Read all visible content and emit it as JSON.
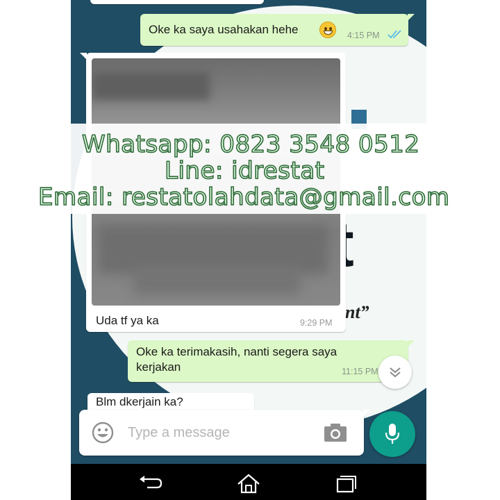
{
  "chat": {
    "messages": [
      {
        "direction": "outgoing",
        "text": "Oke ka saya usahakan hehe",
        "time": "4:15 PM",
        "emoji": "grinning-face",
        "status": "read"
      },
      {
        "direction": "incoming",
        "type": "image",
        "caption": "Uda tf ya ka",
        "time": "9:29 PM"
      },
      {
        "direction": "outgoing",
        "text_line1": "Oke ka terimakasih, nanti segera saya",
        "text_line2": "kerjakan",
        "time": "11:15 PM"
      },
      {
        "direction": "incoming",
        "text": "Blm dkerjain ka?"
      }
    ]
  },
  "input": {
    "placeholder": "Type a message"
  },
  "icons": {
    "emoji_button": "smiley-icon",
    "camera_button": "camera-icon",
    "send_button": "mic-icon",
    "scroll_down": "double-chevron-down-icon",
    "nav_back": "back-icon",
    "nav_home": "home-icon",
    "nav_recents": "recents-icon"
  },
  "watermark": {
    "line1": "Whatsapp: 0823 3548 0512",
    "line2": "Line: idrestat",
    "line3": "Email: restatolahdata@gmail.com"
  },
  "wallpaper": {
    "logo_letters": "at",
    "tagline_fragment": "nt”"
  },
  "colors": {
    "outgoing_bubble": "#dcf8c6",
    "incoming_bubble": "#ffffff",
    "accent": "#0d9e8c",
    "read_ticks": "#4fb6ec",
    "background": "#1f4d64"
  }
}
